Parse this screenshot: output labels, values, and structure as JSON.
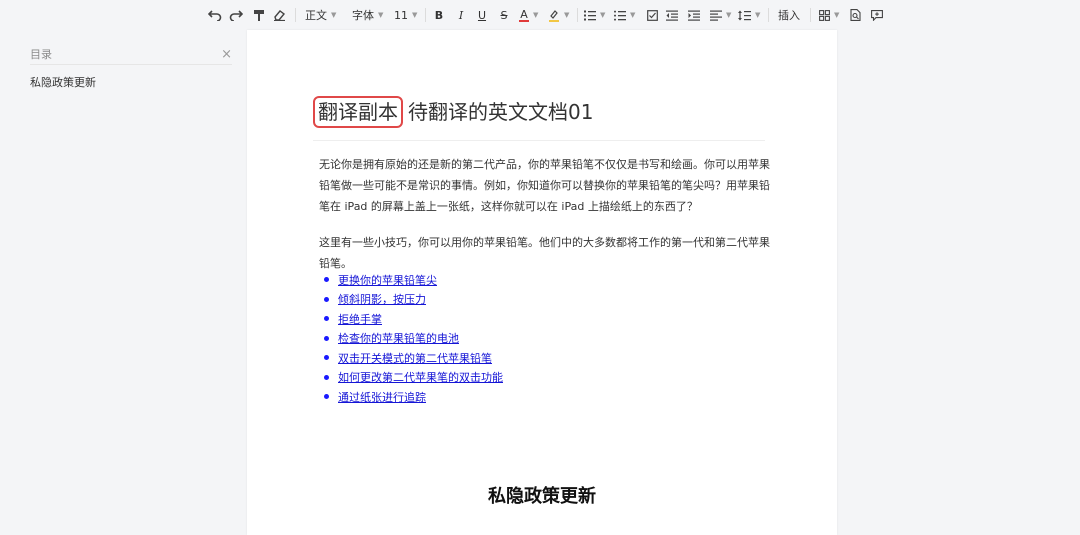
{
  "toolbar": {
    "style_label": "正文",
    "font_label": "字体",
    "size_label": "11",
    "bold_label": "B",
    "italic_label": "I",
    "underline_label": "U",
    "strike_label": "S",
    "font_color_label": "A",
    "insert_label": "插入",
    "font_color": "#e03a3a",
    "highlight_color": "#f2c744"
  },
  "sidebar": {
    "title": "目录",
    "close_glyph": "×",
    "items": [
      "私隐政策更新"
    ]
  },
  "document": {
    "title_highlight": "翻译副本",
    "title_rest": "待翻译的英文文档01",
    "paragraph1": "无论你是拥有原始的还是新的第二代产品，你的苹果铅笔不仅仅是书写和绘画。你可以用苹果铅笔做一些可能不是常识的事情。例如，你知道你可以替换你的苹果铅笔的笔尖吗？用苹果铅笔在 iPad 的屏幕上盖上一张纸，这样你就可以在 iPad 上描绘纸上的东西了？",
    "paragraph2": "这里有一些小技巧，你可以用你的苹果铅笔。他们中的大多数都将工作的第一代和第二代苹果铅笔。",
    "links": [
      "更换你的苹果铅笔尖",
      "倾斜阴影，按压力",
      "拒绝手掌",
      "检查你的苹果铅笔的电池",
      "双击开关模式的第二代苹果铅笔",
      "如何更改第二代苹果笔的双击功能",
      "通过纸张进行追踪"
    ],
    "section_heading": "私隐政策更新",
    "highlight_border_color": "#e04848",
    "link_color": "#1515d6"
  }
}
